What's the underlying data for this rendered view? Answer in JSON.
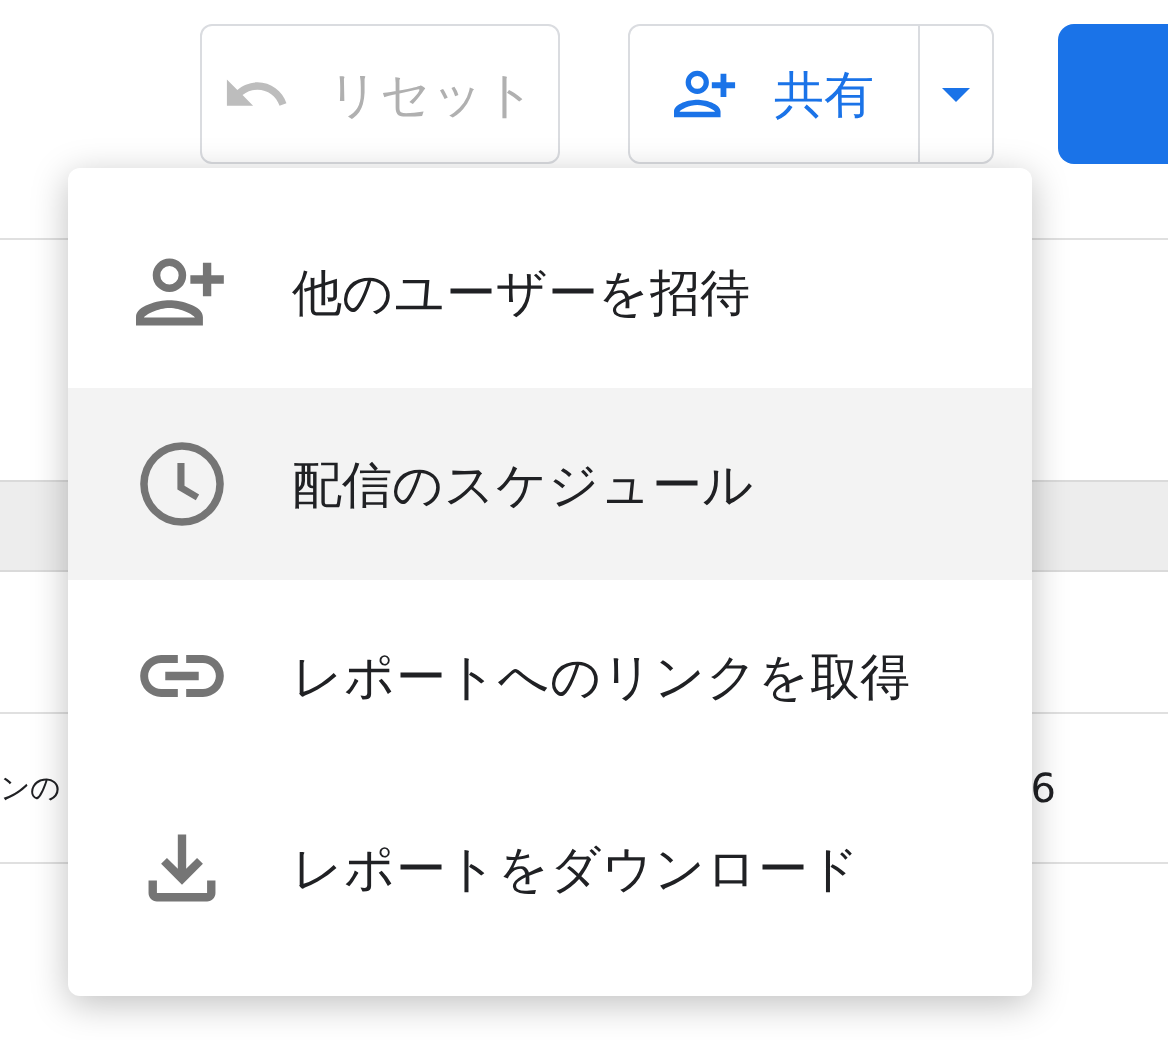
{
  "toolbar": {
    "reset_button": {
      "label": "リセット",
      "disabled": true
    },
    "share_button": {
      "label": "共有"
    }
  },
  "table": {
    "rows": [
      {
        "column_1": "ンの",
        "column_2": "6"
      }
    ]
  },
  "share_menu": {
    "items": [
      {
        "kind": "invite",
        "label": "他のユーザーを招待",
        "highlighted": false
      },
      {
        "kind": "schedule",
        "label": "配信のスケジュール",
        "highlighted": true
      },
      {
        "kind": "link",
        "label": "レポートへのリンクを取得",
        "highlighted": false
      },
      {
        "kind": "download",
        "label": "レポートをダウンロード",
        "highlighted": false
      }
    ]
  }
}
